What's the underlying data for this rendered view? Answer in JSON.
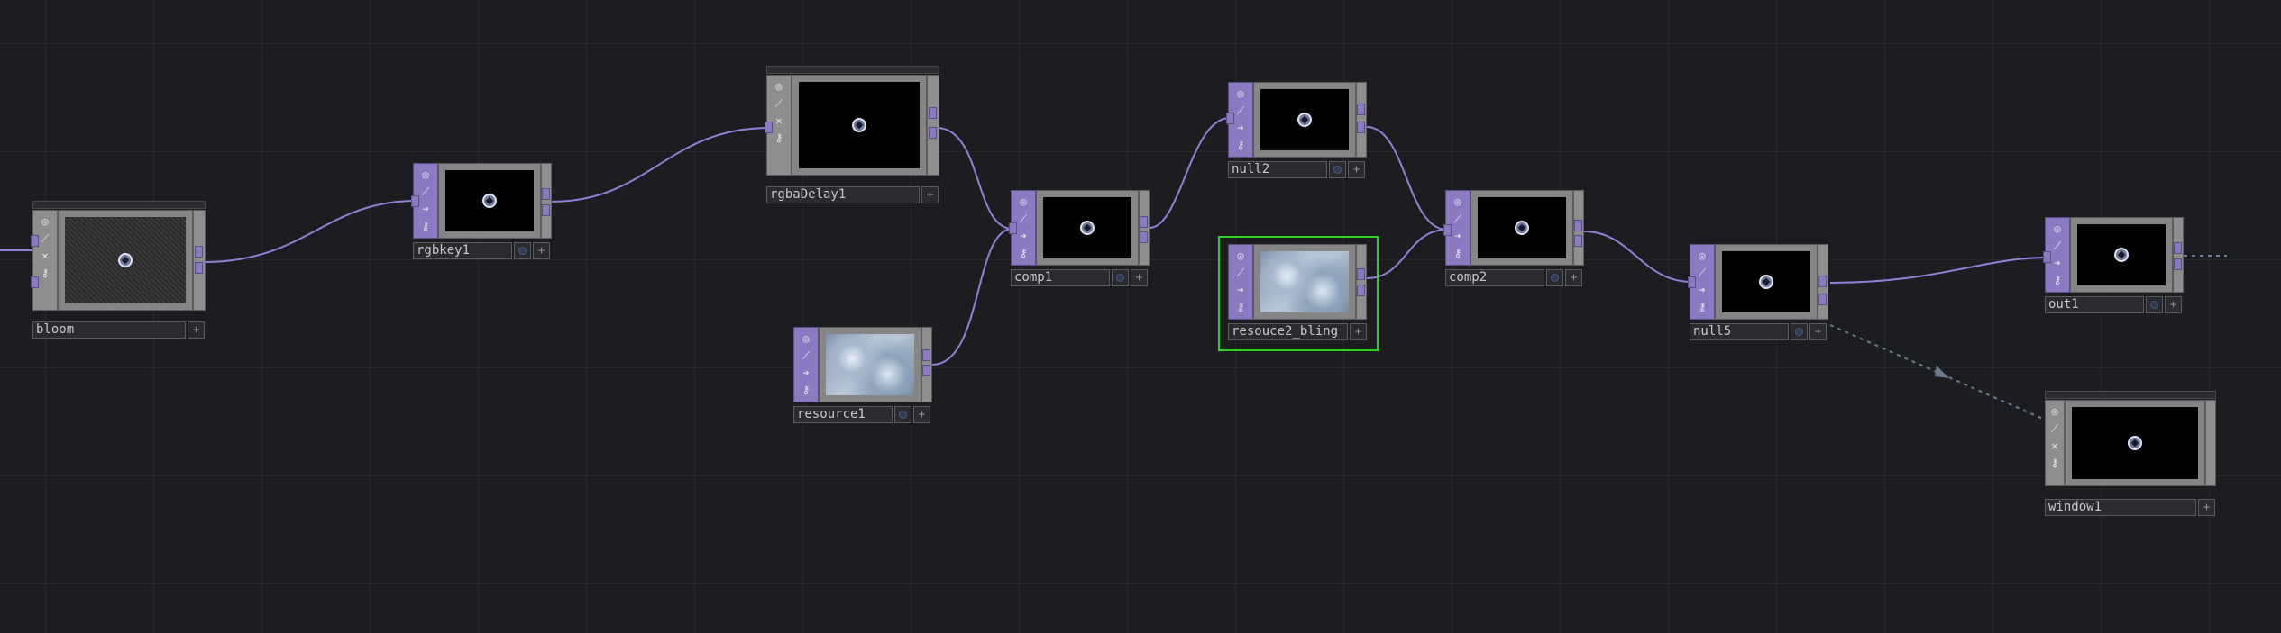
{
  "network": {
    "nodes": [
      {
        "id": "bloom",
        "label": "bloom"
      },
      {
        "id": "rgbkey1",
        "label": "rgbkey1"
      },
      {
        "id": "rgbaDelay1",
        "label": "rgbaDelay1"
      },
      {
        "id": "resource1",
        "label": "resource1"
      },
      {
        "id": "comp1",
        "label": "comp1"
      },
      {
        "id": "null2",
        "label": "null2"
      },
      {
        "id": "resouce2_bling",
        "label": "resouce2_bling"
      },
      {
        "id": "comp2",
        "label": "comp2"
      },
      {
        "id": "null5",
        "label": "null5"
      },
      {
        "id": "out1",
        "label": "out1"
      },
      {
        "id": "window1",
        "label": "window1"
      }
    ],
    "selected_node": "resouce2_bling",
    "colors": {
      "background": "#1c1d21",
      "top_node": "#8b79c2",
      "selection": "#2bd21f",
      "wire": "#8f82d6"
    },
    "flag_icons": [
      "viewer-icon",
      "cook-icon",
      "bypass-icon",
      "lock-icon"
    ],
    "icons": {
      "plus": "+",
      "dot": "•"
    }
  }
}
